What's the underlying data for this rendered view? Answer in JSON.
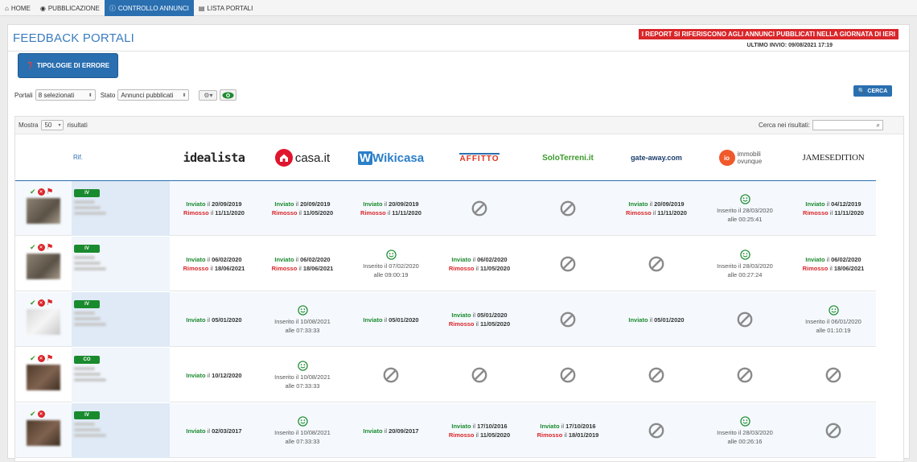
{
  "nav": {
    "tabs": [
      {
        "label": "HOME",
        "icon": "home-icon"
      },
      {
        "label": "PUBBLICAZIONE",
        "icon": "globe-icon"
      },
      {
        "label": "CONTROLLO ANNUNCI",
        "icon": "info-icon"
      },
      {
        "label": "LISTA PORTALI",
        "icon": "book-icon"
      }
    ],
    "active_index": 2
  },
  "page": {
    "title": "FEEDBACK PORTALI",
    "report_banner": "I REPORT SI RIFERISCONO AGLI ANNUNCI PUBBLICATI NELLA GIORNATA DI IERI",
    "last_send": "ULTIMO INVIO: 09/08/2021 17:19",
    "tipologie_button": "TIPOLOGIE DI ERRORE"
  },
  "filters": {
    "portali_label": "Portali",
    "portali_value": "8 selezionati",
    "stato_label": "Stato",
    "stato_value": "Annunci pubblicati",
    "search_button": "CERCA"
  },
  "table": {
    "show_label": "Mostra",
    "show_value": "50",
    "results_label": "risultati",
    "search_label": "Cerca nei risultati:",
    "rif_header": "Rif.",
    "portals": [
      "idealista",
      "casa.it",
      "Wikicasa",
      "AFFITTO",
      "SoloTerreni.it",
      "gate-away.com",
      "immobili ovunque",
      "JAMESEDITION"
    ],
    "labels": {
      "sent": "Inviato",
      "removed": "Rimosso",
      "inserted": "Inserito",
      "at": "il",
      "time_prefix": "alle"
    },
    "rows": [
      {
        "badge": "IV",
        "flag": true,
        "thumb": "normal",
        "cells": [
          {
            "type": "sent_removed",
            "sent": "20/09/2019",
            "removed": "11/11/2020"
          },
          {
            "type": "sent_removed",
            "sent": "20/09/2019",
            "removed": "11/05/2020"
          },
          {
            "type": "sent_removed",
            "sent": "20/09/2019",
            "removed": "11/11/2020"
          },
          {
            "type": "none"
          },
          {
            "type": "none"
          },
          {
            "type": "sent_removed",
            "sent": "20/09/2019",
            "removed": "11/11/2020"
          },
          {
            "type": "inserted",
            "date": "28/03/2020",
            "time": "00:25:41"
          },
          {
            "type": "sent_removed",
            "sent": "04/12/2019",
            "removed": "11/11/2020"
          }
        ]
      },
      {
        "badge": "IV",
        "flag": true,
        "thumb": "normal",
        "cells": [
          {
            "type": "sent_removed",
            "sent": "06/02/2020",
            "removed": "18/06/2021"
          },
          {
            "type": "sent_removed",
            "sent": "06/02/2020",
            "removed": "18/06/2021"
          },
          {
            "type": "inserted",
            "date": "07/02/2020",
            "time": "09:00:19"
          },
          {
            "type": "sent_removed",
            "sent": "06/02/2020",
            "removed": "11/05/2020"
          },
          {
            "type": "none"
          },
          {
            "type": "none"
          },
          {
            "type": "inserted",
            "date": "28/03/2020",
            "time": "00:27:24"
          },
          {
            "type": "sent_removed",
            "sent": "06/02/2020",
            "removed": "18/06/2021"
          }
        ]
      },
      {
        "badge": "IV",
        "flag": true,
        "thumb": "light",
        "cells": [
          {
            "type": "sent",
            "sent": "05/01/2020"
          },
          {
            "type": "inserted",
            "date": "10/08/2021",
            "time": "07:33:33"
          },
          {
            "type": "sent",
            "sent": "05/01/2020"
          },
          {
            "type": "sent_removed",
            "sent": "05/01/2020",
            "removed": "11/05/2020"
          },
          {
            "type": "none"
          },
          {
            "type": "sent",
            "sent": "05/01/2020"
          },
          {
            "type": "none"
          },
          {
            "type": "inserted",
            "date": "06/01/2020",
            "time": "01:10:19"
          }
        ]
      },
      {
        "badge": "CO",
        "flag": true,
        "thumb": "dark",
        "cells": [
          {
            "type": "sent",
            "sent": "10/12/2020"
          },
          {
            "type": "inserted",
            "date": "10/08/2021",
            "time": "07:33:33"
          },
          {
            "type": "none"
          },
          {
            "type": "none"
          },
          {
            "type": "none"
          },
          {
            "type": "none"
          },
          {
            "type": "none"
          },
          {
            "type": "none"
          }
        ]
      },
      {
        "badge": "IV",
        "flag": false,
        "thumb": "dark",
        "cells": [
          {
            "type": "sent",
            "sent": "02/03/2017"
          },
          {
            "type": "inserted",
            "date": "10/08/2021",
            "time": "07:33:33"
          },
          {
            "type": "sent",
            "sent": "20/09/2017"
          },
          {
            "type": "sent_removed",
            "sent": "17/10/2016",
            "removed": "11/05/2020"
          },
          {
            "type": "sent_removed",
            "sent": "17/10/2016",
            "removed": "18/01/2019"
          },
          {
            "type": "none"
          },
          {
            "type": "inserted",
            "date": "28/03/2020",
            "time": "00:26:16"
          },
          {
            "type": "none"
          }
        ]
      }
    ]
  },
  "colors": {
    "primary": "#2a6fb0",
    "banner_red": "#d9262a",
    "sent_green": "#1a8a2e",
    "removed_red": "#d9262a",
    "none_grey": "#8a8a8a"
  }
}
